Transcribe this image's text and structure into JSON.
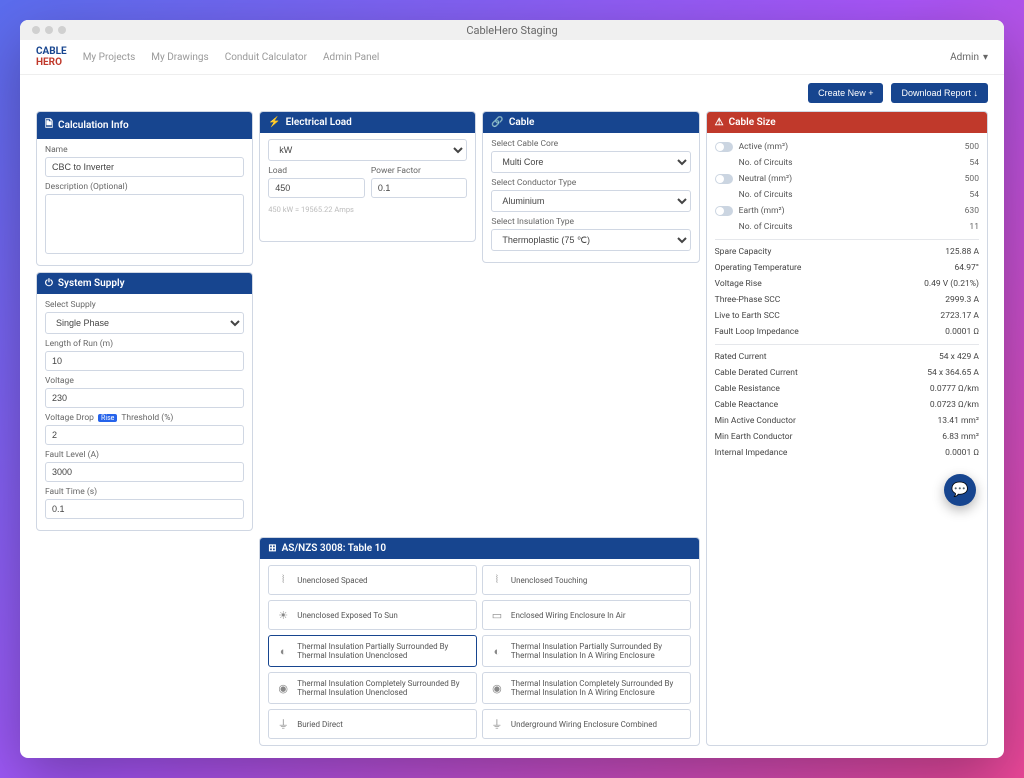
{
  "window_title": "CableHero Staging",
  "logo": {
    "line1": "CABLE",
    "line2": "HERO"
  },
  "nav": {
    "links": [
      "My Projects",
      "My Drawings",
      "Conduit Calculator",
      "Admin Panel"
    ],
    "user": "Admin"
  },
  "actions": {
    "create": "Create New +",
    "download": "Download Report ↓"
  },
  "calc_info": {
    "title": "Calculation Info",
    "name_label": "Name",
    "name_value": "CBC to Inverter",
    "desc_label": "Description (Optional)",
    "desc_value": ""
  },
  "electrical_load": {
    "title": "Electrical Load",
    "unit": "kW",
    "load_label": "Load",
    "load_value": "450",
    "pf_label": "Power Factor",
    "pf_value": "0.1",
    "hint": "450 kW = 19565.22 Amps"
  },
  "cable": {
    "title": "Cable",
    "core_label": "Select Cable Core",
    "core_value": "Multi Core",
    "conductor_label": "Select Conductor Type",
    "conductor_value": "Aluminium",
    "insulation_label": "Select Insulation Type",
    "insulation_value": "Thermoplastic (75 ℃)"
  },
  "system_supply": {
    "title": "System Supply",
    "supply_label": "Select Supply",
    "supply_value": "Single Phase",
    "length_label": "Length of Run (m)",
    "length_value": "10",
    "voltage_label": "Voltage",
    "voltage_value": "230",
    "vd_label_pre": "Voltage",
    "vd_label_mid": "Drop",
    "vd_badge": "Rise",
    "vd_label_post": "Threshold (%)",
    "vd_value": "2",
    "fault_level_label": "Fault Level (A)",
    "fault_level_value": "3000",
    "fault_time_label": "Fault Time (s)",
    "fault_time_value": "0.1"
  },
  "standard": {
    "title": "AS/NZS 3008: Table 10",
    "tiles": [
      {
        "label": "Unenclosed Spaced",
        "icon": "⦚"
      },
      {
        "label": "Unenclosed Touching",
        "icon": "⦚"
      },
      {
        "label": "Unenclosed Exposed To Sun",
        "icon": "☀"
      },
      {
        "label": "Enclosed Wiring Enclosure In Air",
        "icon": "▭"
      },
      {
        "label": "Thermal Insulation Partially Surrounded By Thermal Insulation Unenclosed",
        "icon": "◐",
        "selected": true
      },
      {
        "label": "Thermal Insulation Partially Surrounded By Thermal Insulation In A Wiring Enclosure",
        "icon": "◐"
      },
      {
        "label": "Thermal Insulation Completely Surrounded By Thermal Insulation Unenclosed",
        "icon": "◉"
      },
      {
        "label": "Thermal Insulation Completely Surrounded By Thermal Insulation In A Wiring Enclosure",
        "icon": "◉"
      },
      {
        "label": "Buried Direct",
        "icon": "⏚"
      },
      {
        "label": "Underground Wiring Enclosure Combined",
        "icon": "⏚"
      }
    ]
  },
  "cable_size": {
    "title": "Cable Size",
    "conductors": [
      {
        "name": "Active (mm²)",
        "value": "500",
        "circuits_label": "No. of Circuits",
        "circuits_value": "54"
      },
      {
        "name": "Neutral (mm²)",
        "value": "500",
        "circuits_label": "No. of Circuits",
        "circuits_value": "54"
      },
      {
        "name": "Earth (mm²)",
        "value": "630",
        "circuits_label": "No. of Circuits",
        "circuits_value": "11"
      }
    ],
    "stats1": [
      {
        "label": "Spare Capacity",
        "value": "125.88 A"
      },
      {
        "label": "Operating Temperature",
        "value": "64.97°"
      },
      {
        "label": "Voltage Rise",
        "value": "0.49 V (0.21%)"
      },
      {
        "label": "Three-Phase SCC",
        "value": "2999.3 A"
      },
      {
        "label": "Live to Earth SCC",
        "value": "2723.17 A"
      },
      {
        "label": "Fault Loop Impedance",
        "value": "0.0001 Ω"
      }
    ],
    "stats2": [
      {
        "label": "Rated Current",
        "value": "54 x 429 A"
      },
      {
        "label": "Cable Derated Current",
        "value": "54 x 364.65 A"
      },
      {
        "label": "Cable Resistance",
        "value": "0.0777 Ω/km"
      },
      {
        "label": "Cable Reactance",
        "value": "0.0723 Ω/km"
      },
      {
        "label": "Min Active Conductor",
        "value": "13.41 mm²"
      },
      {
        "label": "Min Earth Conductor",
        "value": "6.83 mm²"
      },
      {
        "label": "Internal Impedance",
        "value": "0.0001 Ω"
      }
    ]
  }
}
